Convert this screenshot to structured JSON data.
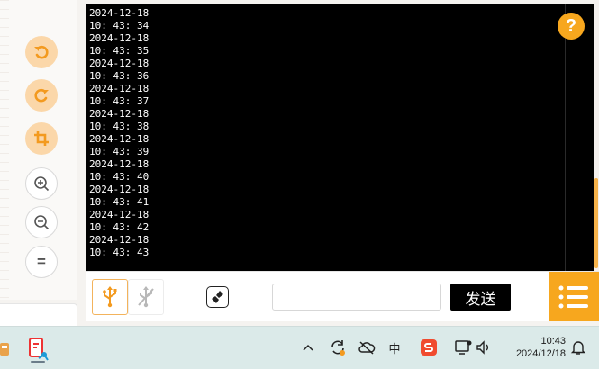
{
  "terminal": {
    "lines": [
      "2024-12-18",
      "10: 43: 34",
      "2024-12-18",
      "10: 43: 35",
      "2024-12-18",
      "10: 43: 36",
      "2024-12-18",
      "10: 43: 37",
      "2024-12-18",
      "10: 43: 38",
      "2024-12-18",
      "10: 43: 39",
      "2024-12-18",
      "10: 43: 40",
      "2024-12-18",
      "10: 43: 41",
      "2024-12-18",
      "10: 43: 42",
      "2024-12-18",
      "10: 43: 43"
    ]
  },
  "help": {
    "label": "?"
  },
  "tools": [
    {
      "name": "undo",
      "icon": "undo-icon"
    },
    {
      "name": "redo",
      "icon": "redo-icon"
    },
    {
      "name": "crop",
      "icon": "crop-icon"
    },
    {
      "name": "zoom-in",
      "icon": "zoom-in-icon"
    },
    {
      "name": "zoom-out",
      "icon": "zoom-out-icon"
    },
    {
      "name": "fit",
      "icon": "equals-icon",
      "label": "="
    }
  ],
  "controls": {
    "send_label": "发送",
    "input_value": "",
    "accent": "#f7a71e"
  },
  "taskbar": {
    "time": "10:43",
    "date": "2024/12/18",
    "ime_label": "中"
  }
}
